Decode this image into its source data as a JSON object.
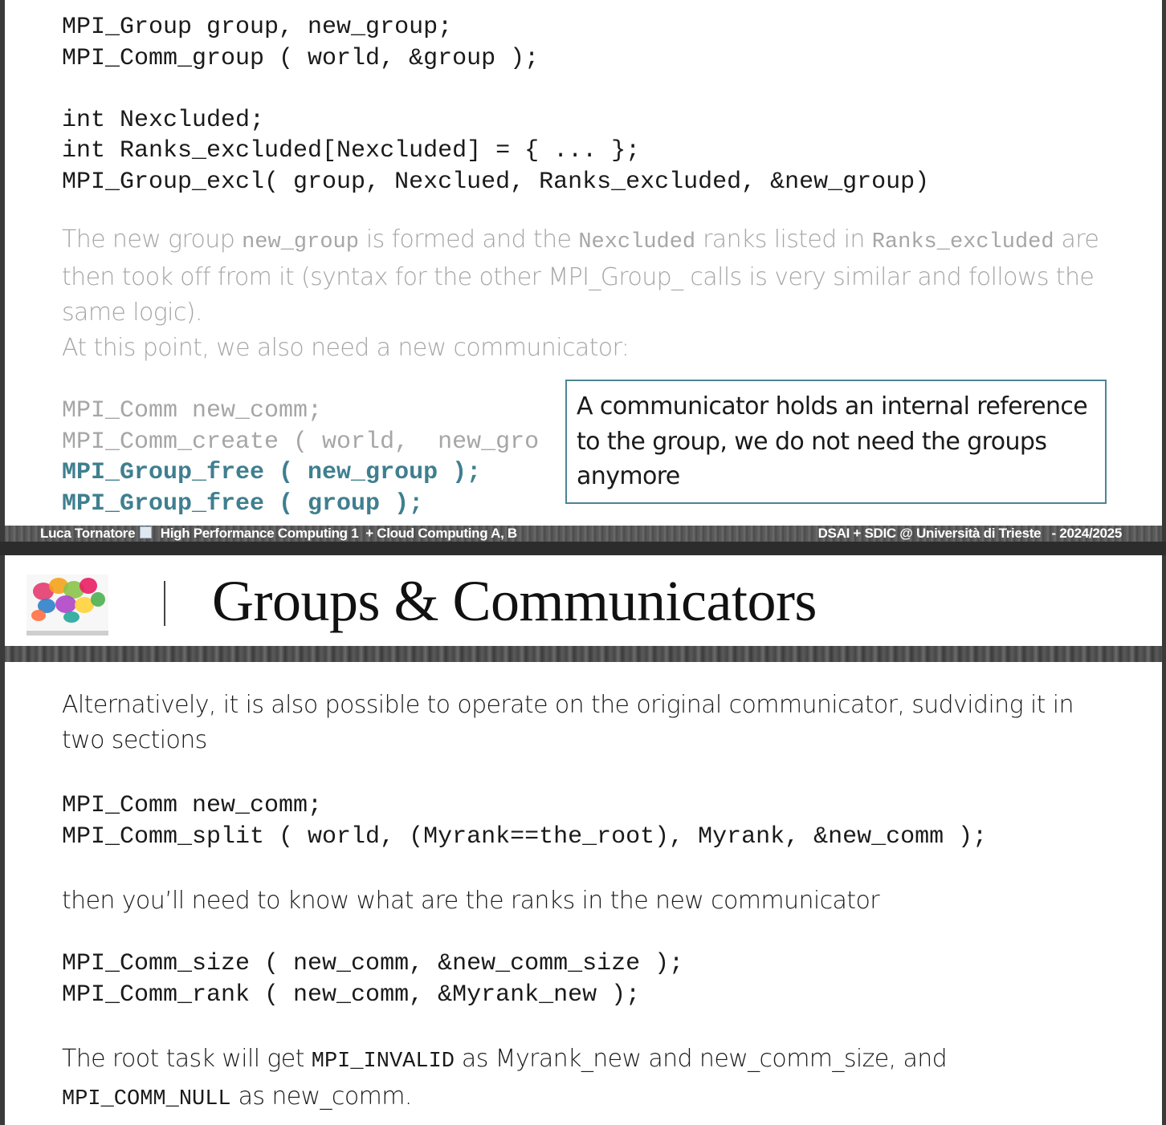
{
  "slide1": {
    "code_top": [
      "MPI_Group group, new_group;",
      "MPI_Comm_group ( world, &group );",
      "",
      "int Nexcluded;",
      "int Ranks_excluded[Nexcluded] = { ... };",
      "MPI_Group_excl( group, Nexclued, Ranks_excluded, &new_group)"
    ],
    "para": {
      "t1": "The new group ",
      "c1": "new_group",
      "t2": " is formed and the ",
      "c2": "Nexcluded",
      "t3": " ranks listed in ",
      "c3": "Ranks_excluded",
      "t4": " are then took off from it (syntax for the other MPI_Group_ calls is very similar and follows the same logic).",
      "t5": "At this point, we also need a new communicator:"
    },
    "code_bottom": {
      "l1": "MPI_Comm new_comm;",
      "l2": "MPI_Comm_create ( world,  new_gro",
      "l3": "MPI_Group_free ( new_group );",
      "l4": "MPI_Group_free ( group );"
    },
    "callout": "A communicator holds an internal reference to the group, we do not need the groups anymore"
  },
  "footer": {
    "author": "Luca Tornatore",
    "course": "High Performance Computing 1  + Cloud Computing A, B",
    "institution": "DSAI + SDIC @ Università di Trieste   - 2024/2025"
  },
  "slide2": {
    "title": "Groups & Communicators",
    "intro": "Alternatively, it is also possible to operate on the original communicator, sudviding it in two sections",
    "code1": [
      "MPI_Comm new_comm;",
      "MPI_Comm_split ( world, (Myrank==the_root), Myrank, &new_comm );"
    ],
    "mid": "then you’ll need to know what are the ranks in the new communicator",
    "code2": [
      "MPI_Comm_size ( new_comm, &new_comm_size );",
      "MPI_Comm_rank ( new_comm, &Myrank_new );"
    ],
    "last": {
      "t1": "The root task will get ",
      "c1": "MPI_INVALID",
      "t2": " as Myrank_new and new_comm_size, and ",
      "c2": "MPI_COMM_NULL",
      "t3": "  as new_comm."
    }
  },
  "colors": {
    "highlight": "#3f7f8f",
    "faded": "#a6a6a6",
    "callout_border": "#4d8593"
  }
}
